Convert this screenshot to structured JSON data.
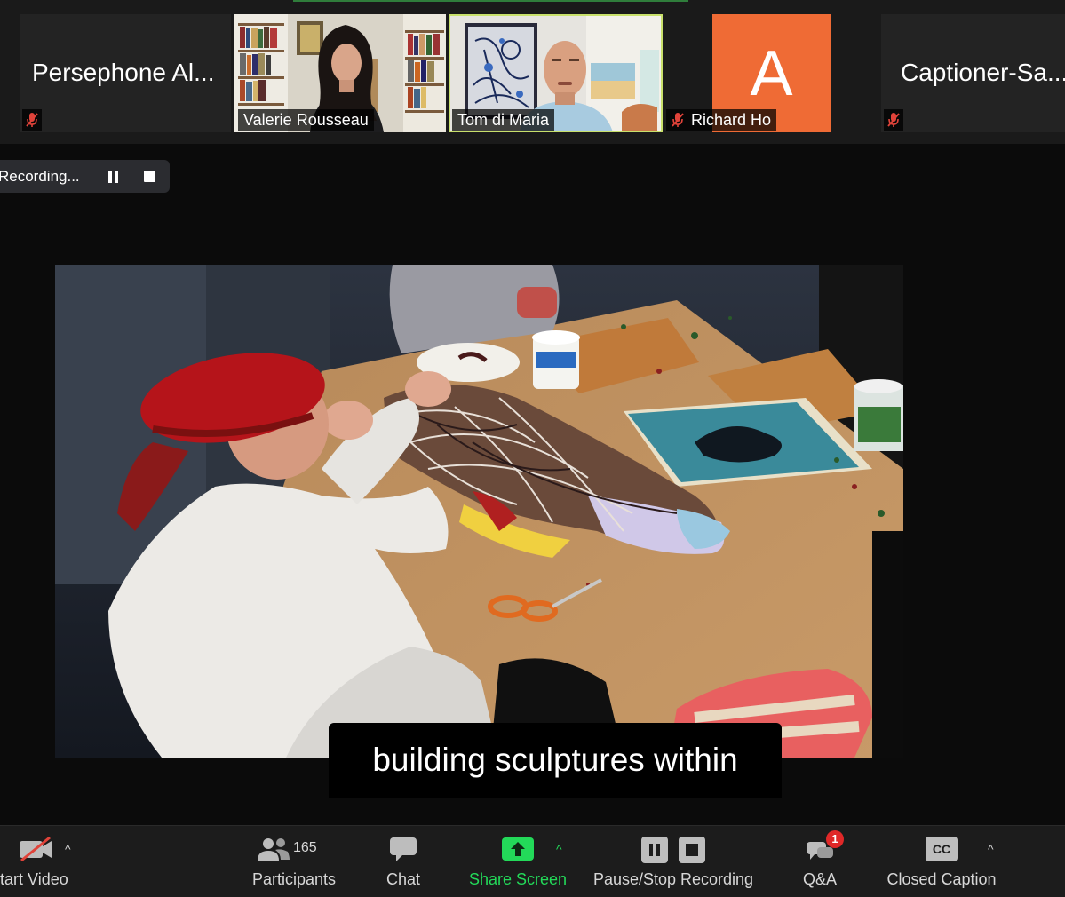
{
  "gallery": {
    "tiles": [
      {
        "name": "Persephone Al...",
        "muted": true
      },
      {
        "name": "Valerie Rousseau",
        "muted": false
      },
      {
        "name": "Tom di Maria",
        "muted": false,
        "active_speaker": true
      },
      {
        "name": "Richard Ho",
        "avatar_letter": "A",
        "avatar_color": "#ef6b35",
        "muted": true
      },
      {
        "name": "Captioner-Sa...",
        "muted": true
      }
    ]
  },
  "recording": {
    "label": "Recording...",
    "pause_icon": "pause-icon",
    "stop_icon": "stop-icon"
  },
  "caption": {
    "text": "building sculptures within"
  },
  "toolbar": {
    "start_video": {
      "label": "tart Video",
      "icon": "video-off-icon"
    },
    "participants": {
      "label": "Participants",
      "count": "165",
      "icon": "participants-icon"
    },
    "chat": {
      "label": "Chat",
      "icon": "chat-icon"
    },
    "share_screen": {
      "label": "Share Screen",
      "icon": "share-screen-icon",
      "color": "#23d959"
    },
    "recording": {
      "label": "Pause/Stop Recording"
    },
    "qa": {
      "label": "Q&A",
      "badge": "1",
      "icon": "qa-icon"
    },
    "closed_caption": {
      "label": "Closed Caption",
      "icon_text": "CC"
    }
  },
  "colors": {
    "accent_active": "#c8e06b",
    "muted_icon": "#e0433a",
    "badge": "#e02828"
  }
}
